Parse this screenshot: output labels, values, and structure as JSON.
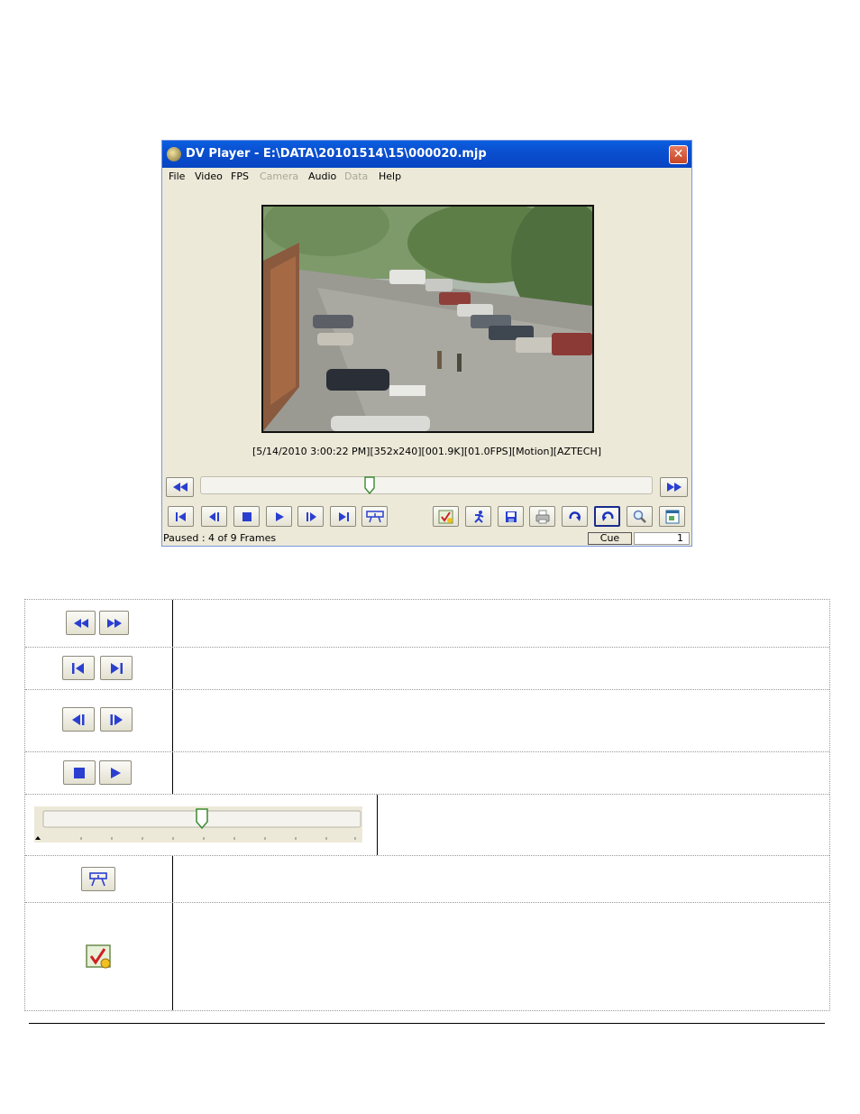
{
  "window": {
    "title": "DV Player - E:\\DATA\\20101514\\15\\000020.mjp",
    "close_glyph": "✕",
    "menu": [
      {
        "label": "File",
        "enabled": true
      },
      {
        "label": "Video",
        "enabled": true
      },
      {
        "label": "FPS",
        "enabled": true
      },
      {
        "label": "Camera",
        "enabled": false
      },
      {
        "label": "Audio",
        "enabled": true
      },
      {
        "label": "Data",
        "enabled": false
      },
      {
        "label": "Help",
        "enabled": true
      }
    ],
    "video": {
      "info_line": "[5/14/2010 3:00:22 PM][352x240][001.9K][01.0FPS][Motion][AZTECH]"
    },
    "seek": {
      "position_fraction": 0.37
    },
    "playback_buttons": [
      "rewind-icon",
      "fast-forward-icon",
      "first-frame-icon",
      "step-back-icon",
      "stop-icon",
      "play-icon",
      "step-forward-icon",
      "last-frame-icon",
      "camera-select-icon"
    ],
    "tool_buttons": [
      "checklist-icon",
      "running-man-icon",
      "save-icon",
      "print-icon",
      "rotate-clockwise-icon",
      "rotate-counterclockwise-icon",
      "zoom-icon",
      "fit-window-icon"
    ],
    "status": {
      "text": "Paused : 4 of 9 Frames",
      "cue_label": "Cue",
      "cue_value": "1"
    }
  },
  "reference_table": {
    "rows": [
      {
        "icons": [
          "rewind-icon",
          "fast-forward-icon"
        ]
      },
      {
        "icons": [
          "first-frame-icon",
          "last-frame-icon"
        ]
      },
      {
        "icons": [
          "step-back-icon",
          "step-forward-icon"
        ]
      },
      {
        "icons": [
          "stop-icon",
          "play-icon"
        ]
      },
      {
        "slider_position_fraction": 0.5
      },
      {
        "icons": [
          "camera-select-icon"
        ]
      },
      {
        "icons": [
          "checklist-icon"
        ]
      }
    ]
  },
  "colors": {
    "window_bg": "#ece9d8",
    "title_blue": "#0a4fd0",
    "icon_blue": "#2a3fd0"
  }
}
